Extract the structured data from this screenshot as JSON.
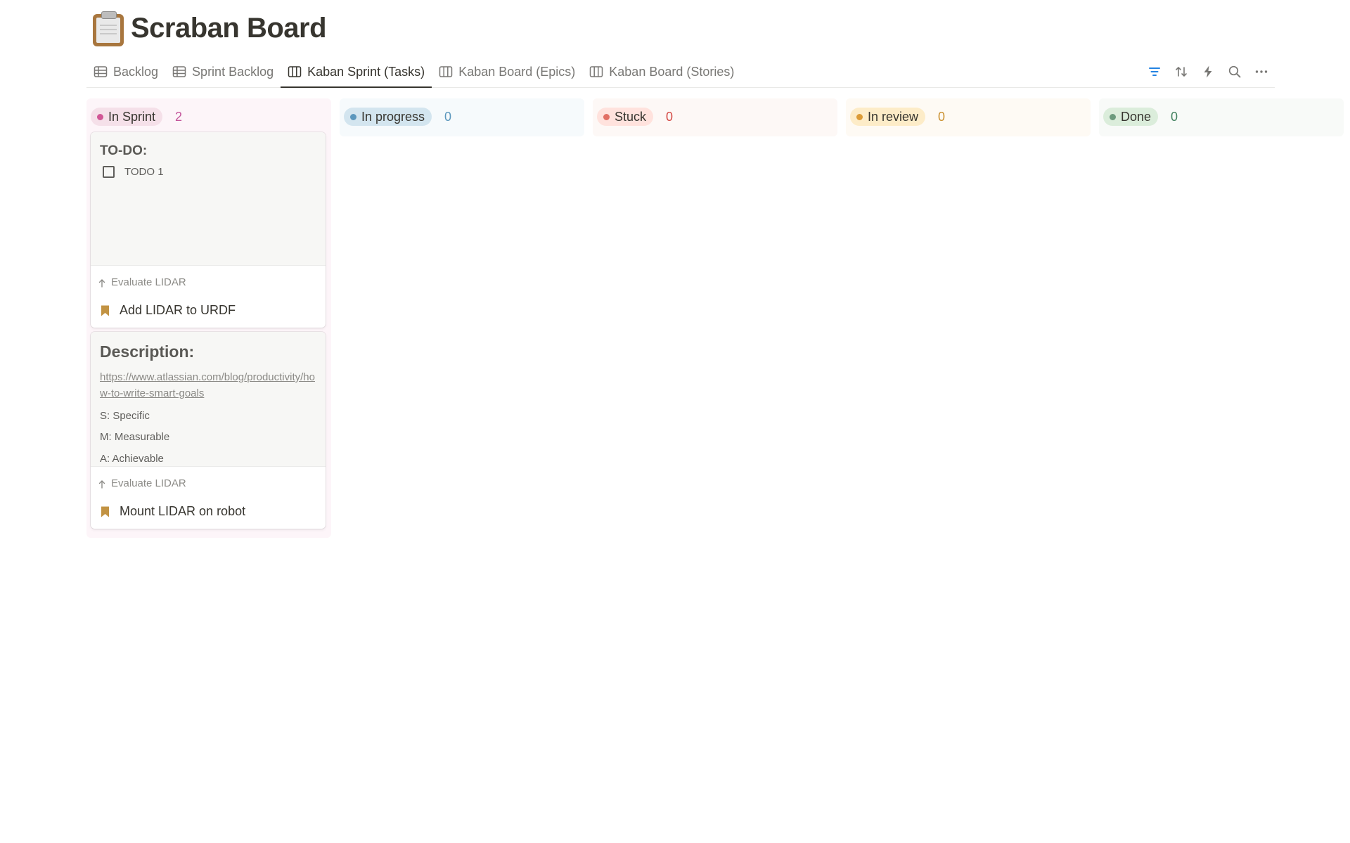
{
  "page": {
    "title": "Scraban Board",
    "icon": "clipboard-icon"
  },
  "tabs": [
    {
      "label": "Backlog",
      "icon": "table-icon",
      "active": false
    },
    {
      "label": "Sprint Backlog",
      "icon": "table-icon",
      "active": false
    },
    {
      "label": "Kaban Sprint (Tasks)",
      "icon": "board-icon",
      "active": true
    },
    {
      "label": "Kaban Board (Epics)",
      "icon": "board-icon",
      "active": false
    },
    {
      "label": "Kaban Board (Stories)",
      "icon": "board-icon",
      "active": false
    }
  ],
  "toolbar": {
    "icons": [
      "filter-icon",
      "sort-icon",
      "lightning-icon",
      "search-icon",
      "more-icon"
    ],
    "filter_color": "#2383e2"
  },
  "columns": [
    {
      "label": "In Sprint",
      "count": "2",
      "dot": "#d15796",
      "pill_bg": "#f5e0e9",
      "count_color": "#c4559b",
      "col_bg": "#fdf5f9"
    },
    {
      "label": "In progress",
      "count": "0",
      "dot": "#5b97bd",
      "pill_bg": "#d3e5ef",
      "count_color": "#5b97bd",
      "col_bg": "#f6fafc"
    },
    {
      "label": "Stuck",
      "count": "0",
      "dot": "#e16f64",
      "pill_bg": "#ffe2dd",
      "count_color": "#d44c47",
      "col_bg": "#fdf8f6"
    },
    {
      "label": "In review",
      "count": "0",
      "dot": "#dc9b36",
      "pill_bg": "#fdecc8",
      "count_color": "#cb912f",
      "col_bg": "#fefaf4"
    },
    {
      "label": "Done",
      "count": "0",
      "dot": "#6c9b7d",
      "pill_bg": "#dbeddb",
      "count_color": "#448361",
      "col_bg": "#f8faf8"
    }
  ],
  "cards": [
    {
      "preview_heading": "TO-DO:",
      "todo_label": "TODO 1",
      "parent": "Evaluate LIDAR",
      "title": "Add LIDAR to URDF",
      "icon": "bookmark-icon"
    },
    {
      "preview_heading": "Description:",
      "link": "https://www.atlassian.com/blog/productivity/how-to-write-smart-goals",
      "lines": [
        "S: Specific",
        "M: Measurable",
        "A: Achievable"
      ],
      "parent": "Evaluate LIDAR",
      "title": "Mount LIDAR on robot",
      "icon": "bookmark-icon"
    }
  ],
  "colors": {
    "bookmark": "#c29343",
    "text": "#37352f",
    "muted": "#787774"
  }
}
